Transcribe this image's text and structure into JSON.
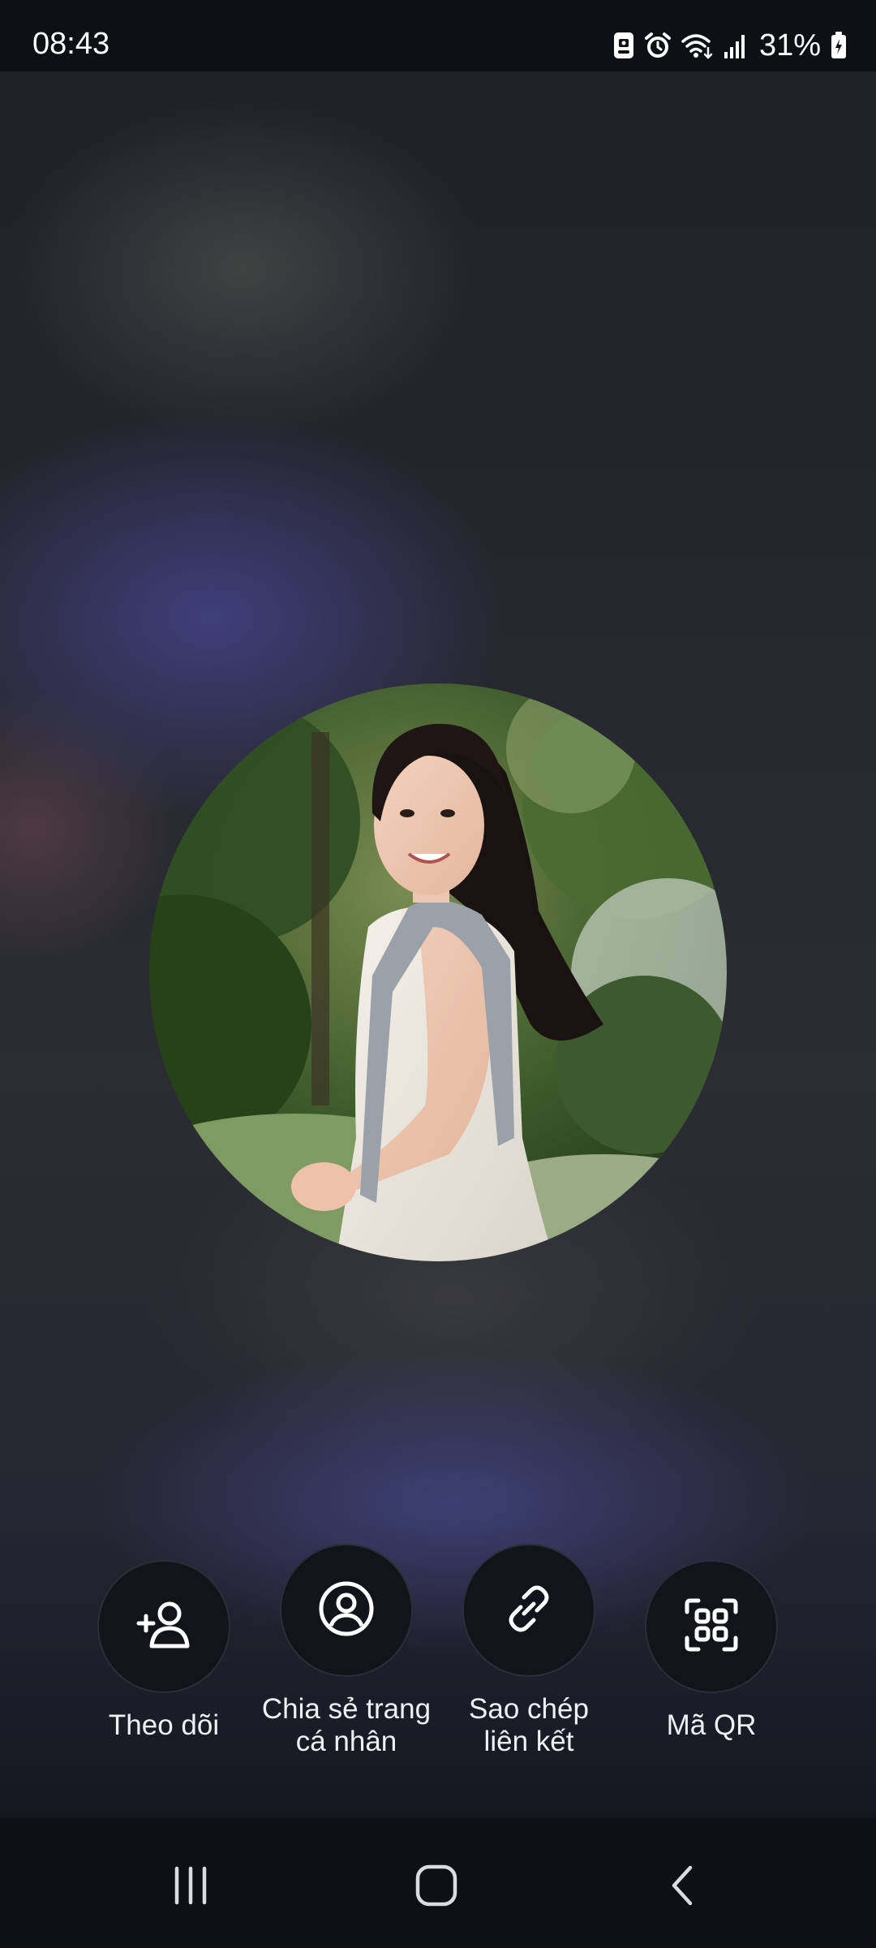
{
  "status_bar": {
    "time": "08:43",
    "battery_percent": "31%",
    "icons": [
      "screenshot-notification-icon",
      "alarm-icon",
      "wifi-icon",
      "signal-icon",
      "battery-charging-icon"
    ]
  },
  "profile": {
    "avatar": "profile-photo"
  },
  "actions": [
    {
      "label": "Theo dõi",
      "icon": "follow-user-icon"
    },
    {
      "label_line1": "Chia sẻ trang",
      "label_line2": "cá nhân",
      "icon": "profile-share-icon"
    },
    {
      "label_line1": "Sao chép",
      "label_line2": "liên kết",
      "icon": "link-icon"
    },
    {
      "label": "Mã QR",
      "icon": "qr-code-icon"
    }
  ],
  "navigation": {
    "icons": [
      "recent-apps-icon",
      "home-icon",
      "back-icon"
    ]
  },
  "colors": {
    "status_bar_bg": "#0d1015",
    "button_bg": "#11141a",
    "text": "#eef0f4"
  }
}
